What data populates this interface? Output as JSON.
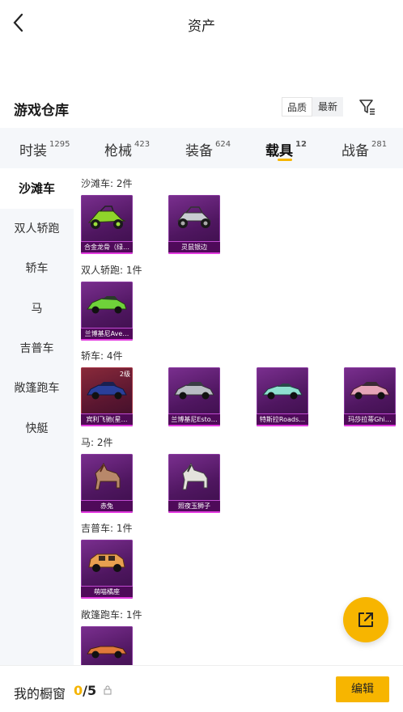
{
  "header": {
    "title": "资产"
  },
  "warehouse": {
    "title": "游戏仓库",
    "sort_options": [
      "品质",
      "最新"
    ]
  },
  "tabs": [
    {
      "label": "时装",
      "count": "1295"
    },
    {
      "label": "枪械",
      "count": "423"
    },
    {
      "label": "装备",
      "count": "624"
    },
    {
      "label": "载具",
      "count": "12"
    },
    {
      "label": "战备",
      "count": "281"
    }
  ],
  "sidebar": {
    "items": [
      "沙滩车",
      "双人轿跑",
      "轿车",
      "马",
      "吉普车",
      "敞篷跑车",
      "快艇"
    ]
  },
  "sections": [
    {
      "title": "沙滩车: 2件",
      "items": [
        {
          "name": "合金龙骨（绿…",
          "icon": "beach-buggy-green-icon"
        },
        {
          "name": "灵鼠银边",
          "icon": "beach-buggy-silver-icon"
        }
      ]
    },
    {
      "title": "双人轿跑: 1件",
      "items": [
        {
          "name": "兰博基尼Ave…",
          "icon": "sports-car-green-icon"
        }
      ]
    },
    {
      "title": "轿车: 4件",
      "items": [
        {
          "name": "宾利飞驰(星…",
          "level": "2级",
          "icon": "sedan-blue-icon"
        },
        {
          "name": "兰博基尼Esto…",
          "icon": "sedan-silver-icon"
        },
        {
          "name": "特斯拉Roads…",
          "icon": "roadster-teal-icon"
        },
        {
          "name": "玛莎拉蒂Ghi…",
          "icon": "sedan-pink-icon"
        }
      ]
    },
    {
      "title": "马: 2件",
      "items": [
        {
          "name": "赤兔",
          "icon": "horse-brown-icon"
        },
        {
          "name": "照夜玉狮子",
          "icon": "horse-white-icon"
        }
      ]
    },
    {
      "title": "吉普车: 1件",
      "items": [
        {
          "name": "萌喵橘座",
          "icon": "jeep-orange-icon"
        }
      ]
    },
    {
      "title": "敞篷跑车: 1件",
      "items": [
        {
          "name": "",
          "icon": "convertible-orange-icon"
        }
      ]
    }
  ],
  "showcase": {
    "label": "我的橱窗",
    "current": "0",
    "separator": "/",
    "max": "5"
  },
  "actions": {
    "edit_label": "编辑"
  },
  "colors": {
    "accent": "#f7b500",
    "card_purple": "#5a1a6e",
    "card_red": "#6a1a30"
  }
}
